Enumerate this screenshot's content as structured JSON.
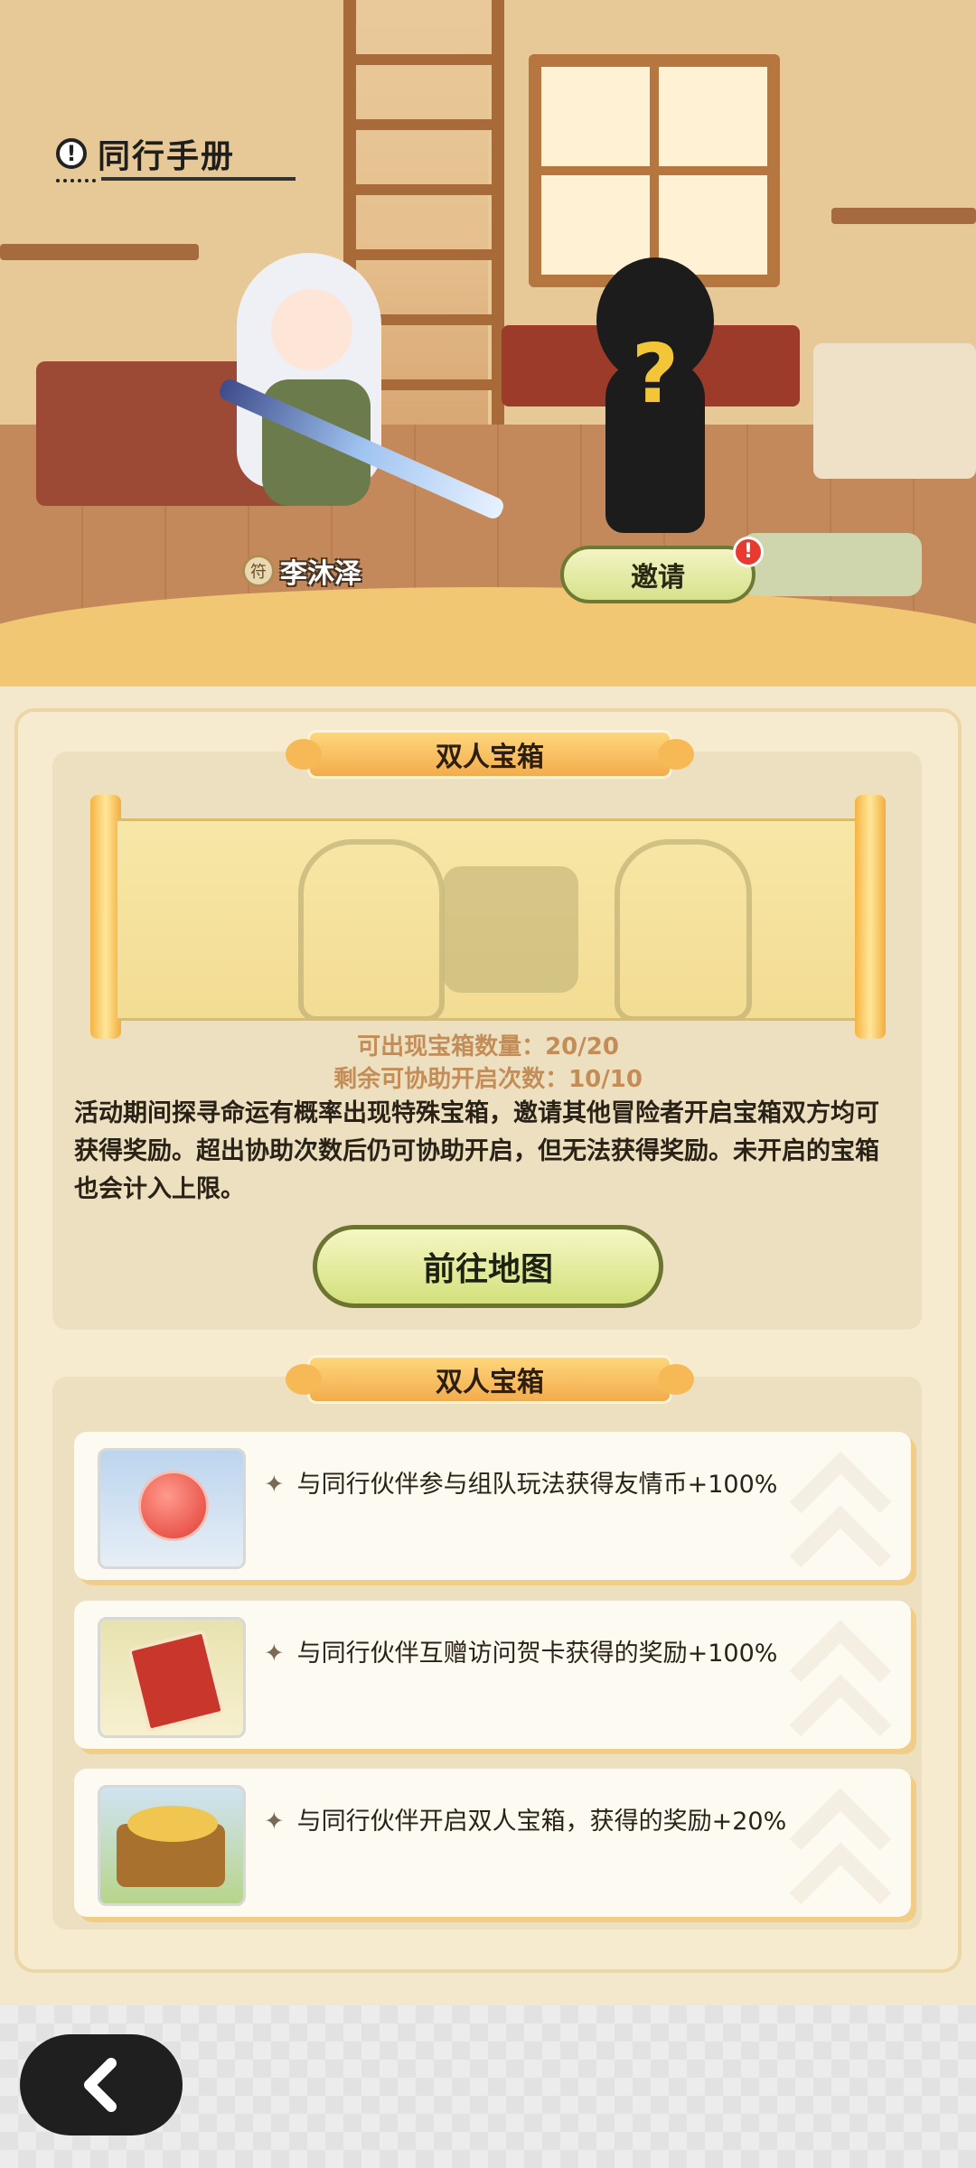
{
  "header": {
    "title": "同行手册",
    "info_icon": "info-icon"
  },
  "partner": {
    "name": "李沐泽",
    "invite_label": "邀请",
    "invite_badge": "!",
    "unknown_mark": "?"
  },
  "chest_section": {
    "title": "双人宝箱",
    "chest_count_label": "可出现宝箱数量：20/20",
    "assist_count_label": "剩余可协助开启次数：10/10",
    "description": "活动期间探寻命运有概率出现特殊宝箱，邀请其他冒险者开启宝箱双方均可获得奖励。超出协助次数后仍可协助开启，但无法获得奖励。未开启的宝箱也会计入上限。",
    "goto_label": "前往地图"
  },
  "perk_section": {
    "title": "双人宝箱",
    "items": [
      {
        "text": "与同行伙伴参与组队玩法获得友情币+100%",
        "icon": "friendship-coin-icon"
      },
      {
        "text": "与同行伙伴互赠访问贺卡获得的奖励+100%",
        "icon": "greeting-card-icon"
      },
      {
        "text": "与同行伙伴开启双人宝箱，获得的奖励+20%",
        "icon": "treasure-pile-icon"
      }
    ],
    "bullet": "✦"
  },
  "nav": {
    "back_icon": "back-arrow-icon"
  }
}
